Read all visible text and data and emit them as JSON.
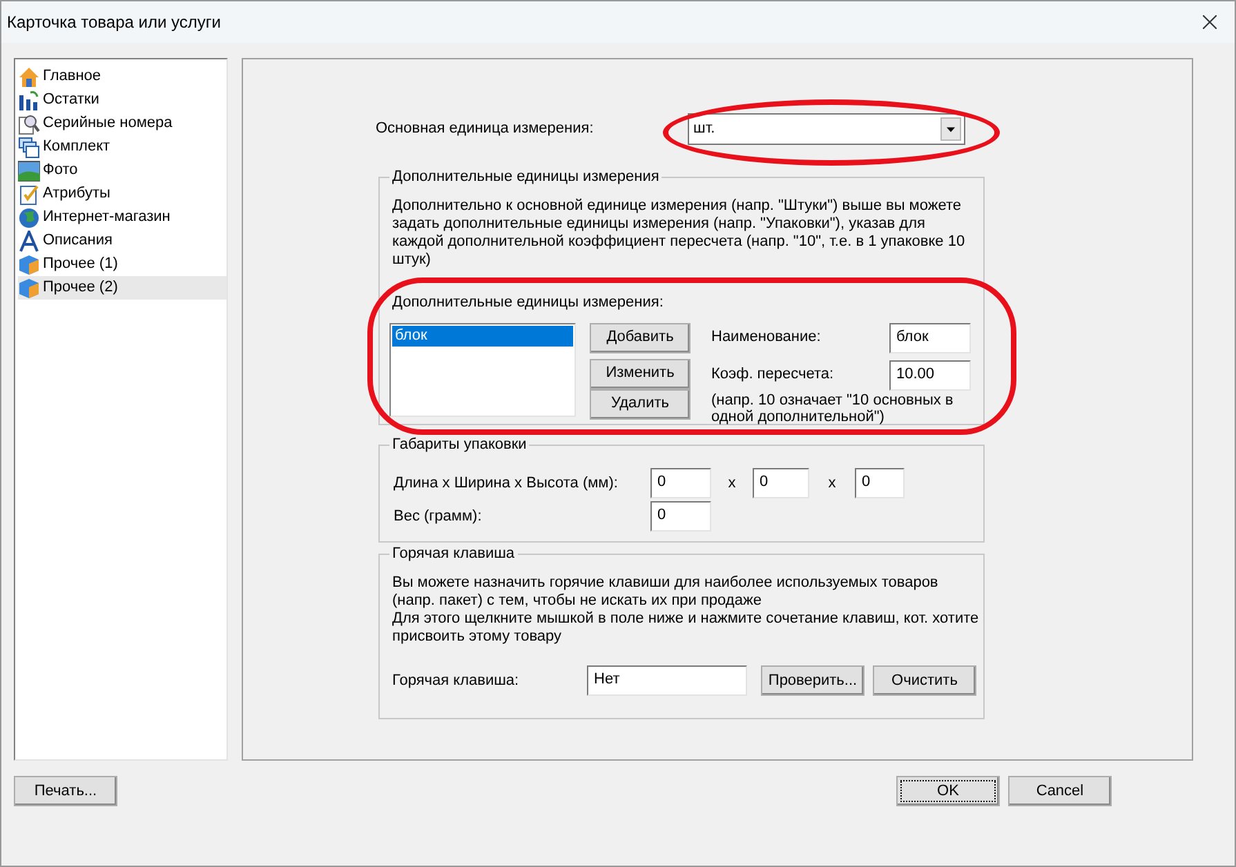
{
  "window": {
    "title": "Карточка товара или услуги"
  },
  "sidebar": {
    "items": [
      {
        "label": "Главное",
        "selected": false
      },
      {
        "label": "Остатки",
        "selected": false
      },
      {
        "label": "Серийные номера",
        "selected": false
      },
      {
        "label": "Комплект",
        "selected": false
      },
      {
        "label": "Фото",
        "selected": false
      },
      {
        "label": "Атрибуты",
        "selected": false
      },
      {
        "label": "Интернет-магазин",
        "selected": false
      },
      {
        "label": "Описания",
        "selected": false
      },
      {
        "label": "Прочее (1)",
        "selected": false
      },
      {
        "label": "Прочее (2)",
        "selected": true
      }
    ]
  },
  "base_unit": {
    "label": "Основная единица измерения:",
    "value": "шт."
  },
  "extra_units": {
    "title": "Дополнительные единицы измерения",
    "description": "Дополнительно к основной единице измерения (напр. \"Штуки\") выше вы можете задать дополнительные единицы измерения (напр. \"Упаковки\"), указав для каждой дополнительной коэффициент пересчета (напр. \"10\", т.е. в 1 упаковке 10 штук)",
    "list_label": "Дополнительные единицы измерения:",
    "list": [
      {
        "text": "блок",
        "selected": true
      }
    ],
    "buttons": [
      "Добавить",
      "Изменить",
      "Удалить"
    ],
    "name_label": "Наименование:",
    "name_value": "блок",
    "factor_label": "Коэф. пересчета:",
    "factor_value": "10.00",
    "factor_hint": "(напр. 10 означает \"10 основных в одной дополнительной\")"
  },
  "package": {
    "title": "Габариты упаковки",
    "dims_label": "Длина х Ширина х Высота (мм):",
    "dims": [
      "0",
      "0",
      "0"
    ],
    "separators": [
      "x",
      "x"
    ],
    "weight_label": "Вес (грамм):",
    "weight": "0"
  },
  "hotkey": {
    "title": "Горячая клавиша",
    "description": [
      "Вы можете назначить горячие клавиши для наиболее используемых товаров (напр. пакет) с тем, чтобы не искать их при продаже",
      "Для этого щелкните мышкой в поле ниже и нажмите сочетание клавиш, кот. хотите присвоить этому товару"
    ],
    "label": "Горячая клавиша:",
    "value": "Нет",
    "buttons": [
      "Проверить...",
      "Очистить"
    ]
  },
  "footer": {
    "print": "Печать...",
    "ok": "OK",
    "cancel": "Cancel"
  }
}
